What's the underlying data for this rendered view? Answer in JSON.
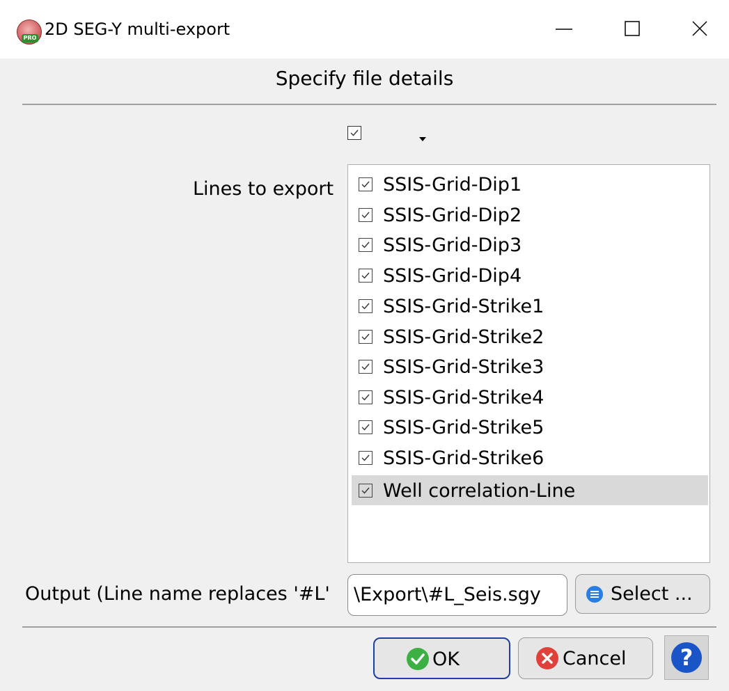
{
  "window": {
    "title": "2D SEG-Y multi-export",
    "icon": "app-pro-icon",
    "controls": [
      "minimize-icon",
      "maximize-icon",
      "close-icon"
    ]
  },
  "header": {
    "heading": "Specify file details"
  },
  "top_toggle": {
    "checked": true,
    "dropdown_icon": "dropdown-arrow-icon"
  },
  "lines": {
    "label": "Lines to export",
    "items": [
      {
        "label": "SSIS-Grid-Dip1",
        "checked": true
      },
      {
        "label": "SSIS-Grid-Dip2",
        "checked": true
      },
      {
        "label": "SSIS-Grid-Dip3",
        "checked": true
      },
      {
        "label": "SSIS-Grid-Dip4",
        "checked": true
      },
      {
        "label": "SSIS-Grid-Strike1",
        "checked": true
      },
      {
        "label": "SSIS-Grid-Strike2",
        "checked": true
      },
      {
        "label": "SSIS-Grid-Strike3",
        "checked": true
      },
      {
        "label": "SSIS-Grid-Strike4",
        "checked": true
      },
      {
        "label": "SSIS-Grid-Strike5",
        "checked": true
      },
      {
        "label": "SSIS-Grid-Strike6",
        "checked": true
      },
      {
        "label": "Well correlation-Line",
        "checked": true,
        "selected": true
      }
    ]
  },
  "output": {
    "label": "Output (Line name replaces '#L'",
    "value": "\\Export\\#L_Seis.sgy",
    "select_label": "Select ..."
  },
  "footer": {
    "ok_label": "OK",
    "cancel_label": "Cancel",
    "help_icon": "help-icon"
  },
  "colors": {
    "ok_green": "#3cb043",
    "cancel_red": "#e0413a",
    "help_blue": "#1a55c8",
    "select_blue": "#2a7de1",
    "ok_border": "#1f3f9f"
  }
}
